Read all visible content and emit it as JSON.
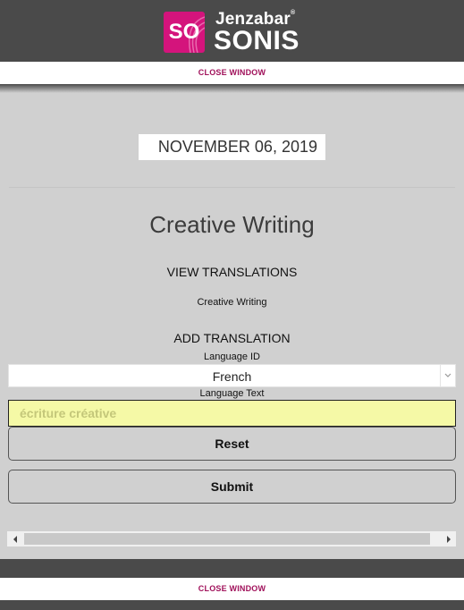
{
  "header": {
    "logo": {
      "mark": "SO",
      "brand": "Jenzabar",
      "brand_reg": "®",
      "product": "SONIS"
    }
  },
  "close_window_label": "CLOSE WINDOW",
  "date": "NOVEMBER 06, 2019",
  "page_title": "Creative Writing",
  "view_translations": {
    "heading": "VIEW TRANSLATIONS",
    "items": [
      "Creative Writing"
    ]
  },
  "add_translation": {
    "heading": "ADD TRANSLATION",
    "language_id_label": "Language ID",
    "language_id_value": "French",
    "language_text_label": "Language Text",
    "language_text_value": "écriture créative",
    "reset_label": "Reset",
    "submit_label": "Submit"
  },
  "colors": {
    "brand_magenta": "#d4147c",
    "close_link": "#a0105a",
    "header_bg": "#4a4a4a",
    "page_bg": "#d0d0d0",
    "input_highlight": "#f5f9a6"
  },
  "icons": {
    "select_arrow": "chevron-down-icon",
    "scroll_left": "caret-left-icon",
    "scroll_right": "caret-right-icon"
  }
}
